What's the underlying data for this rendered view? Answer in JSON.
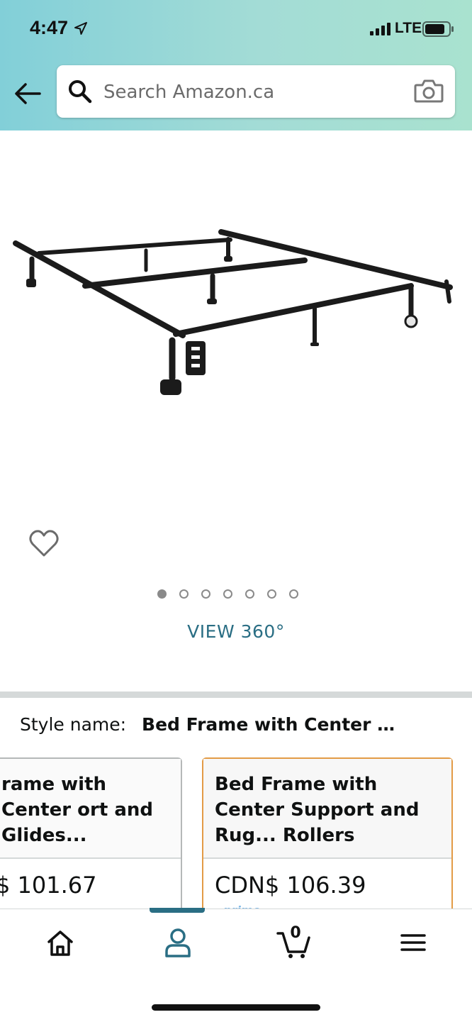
{
  "status_bar": {
    "time": "4:47",
    "network": "LTE"
  },
  "search": {
    "placeholder": "Search Amazon.ca"
  },
  "gallery": {
    "view_360": "VIEW 360°",
    "dot_count": 7,
    "active_index": 0
  },
  "style": {
    "label": "Style name:",
    "value": "Bed Frame with Center …"
  },
  "options": [
    {
      "title": "rame with Center ort and Glides...",
      "price": "$ 101.67",
      "selected": false
    },
    {
      "title": "Bed Frame with Center Support and Rug... Rollers",
      "price": "CDN$ 106.39",
      "selected": true
    }
  ],
  "tabbar": {
    "cart_count": "0",
    "active_tab": "account"
  },
  "colors": {
    "accent": "#2a6e84",
    "selected_border": "#e39b46",
    "header_start": "#82cfd8",
    "header_end": "#a9e2cf"
  }
}
